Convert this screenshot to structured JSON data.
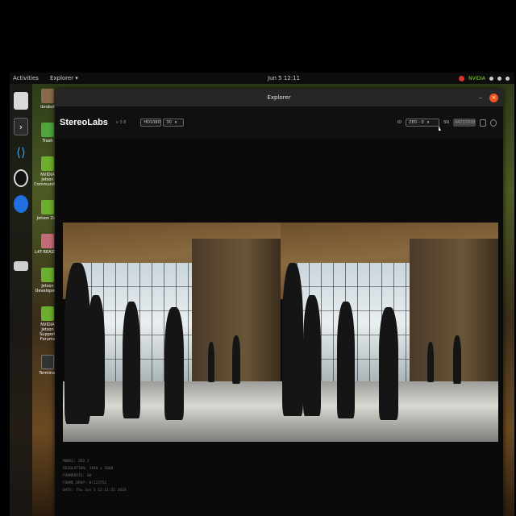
{
  "topbar": {
    "activities": "Activities",
    "app_menu": "Explorer ▾",
    "clock": "Jun 5 12:11",
    "nvidia": "NVIDIA"
  },
  "dock": {
    "items": [
      {
        "icon": "files-icon"
      },
      {
        "icon": "terminal-icon"
      },
      {
        "icon": "vscode-icon"
      },
      {
        "icon": "obs-icon"
      },
      {
        "icon": "chromium-icon"
      },
      {
        "icon": "drive-icon"
      }
    ]
  },
  "desktop": {
    "items": [
      {
        "label": "ibrobot"
      },
      {
        "label": "Trash"
      },
      {
        "label": "NVIDIA Jetson Community P"
      },
      {
        "label": "Jetson Zoo"
      },
      {
        "label": "L4T-README"
      },
      {
        "label": "Jetson Developer Z"
      },
      {
        "label": "NVIDIA Jetson Support Forums"
      },
      {
        "label": "Terminal"
      }
    ]
  },
  "window": {
    "title": "Explorer",
    "brand": "StereoLabs",
    "version": "v 3.8",
    "resolution": "HD1080",
    "fps": "30",
    "device_label": "ID",
    "device_value": "ZED - 0",
    "serial_label": "SN",
    "serial_value": "44233938"
  },
  "info": {
    "lines": [
      "MODEL: ZED 2",
      "RESOLUTION: 3840 x 1080",
      "FRAMERATE: 30",
      "FRAME DROP: 0/123752",
      "DATE: Thu Jun 5 12:11:35 2024"
    ]
  },
  "colors": {
    "accent_close": "#e95420",
    "nvidia_green": "#7fd13b",
    "record_red": "#dd3333"
  }
}
